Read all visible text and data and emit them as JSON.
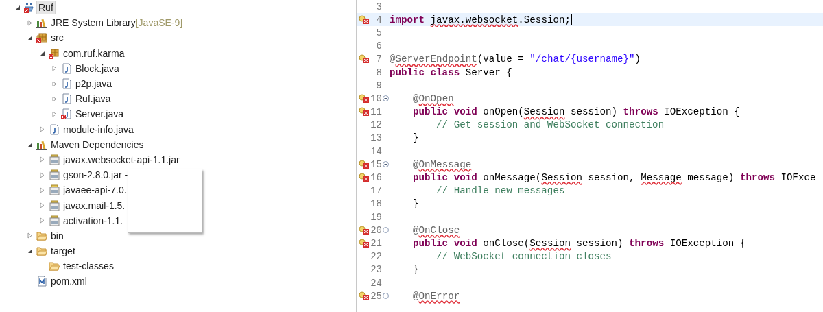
{
  "tree": [
    {
      "label": "Ruf",
      "kind": "project",
      "error": true,
      "selected": true,
      "expanded": true,
      "children": [
        {
          "label": "JRE System Library",
          "suffix": "[JavaSE-9]",
          "kind": "library",
          "error": false,
          "selected": false,
          "expanded": false
        },
        {
          "label": "src",
          "kind": "source-folder",
          "error": true,
          "selected": false,
          "expanded": true,
          "children": [
            {
              "label": "com.ruf.karma",
              "kind": "package",
              "error": true,
              "selected": false,
              "expanded": true,
              "children": [
                {
                  "label": "Block.java",
                  "kind": "java-file",
                  "error": false,
                  "selected": false,
                  "expanded": false
                },
                {
                  "label": "p2p.java",
                  "kind": "java-file",
                  "error": false,
                  "selected": false,
                  "expanded": false
                },
                {
                  "label": "Ruf.java",
                  "kind": "java-file",
                  "error": false,
                  "selected": false,
                  "expanded": false
                },
                {
                  "label": "Server.java",
                  "kind": "java-file",
                  "error": true,
                  "selected": false,
                  "expanded": false
                }
              ]
            },
            {
              "label": "module-info.java",
              "kind": "java-file",
              "error": false,
              "selected": false,
              "expanded": false
            }
          ]
        },
        {
          "label": "Maven Dependencies",
          "kind": "library",
          "error": false,
          "selected": false,
          "expanded": true,
          "children": [
            {
              "label": "javax.websocket-api-1.1.jar",
              "kind": "jar",
              "error": false,
              "selected": false,
              "expanded": false
            },
            {
              "label": "gson-2.8.0.jar -",
              "kind": "jar",
              "error": false,
              "selected": false,
              "expanded": false
            },
            {
              "label": "javaee-api-7.0.",
              "kind": "jar",
              "error": false,
              "selected": false,
              "expanded": false
            },
            {
              "label": "javax.mail-1.5.",
              "kind": "jar",
              "error": false,
              "selected": false,
              "expanded": false
            },
            {
              "label": "activation-1.1.",
              "kind": "jar",
              "error": false,
              "selected": false,
              "expanded": false
            }
          ]
        },
        {
          "label": "bin",
          "kind": "folder",
          "error": false,
          "selected": false,
          "expanded": false
        },
        {
          "label": "target",
          "kind": "folder",
          "error": false,
          "selected": false,
          "expanded": true,
          "children": [
            {
              "label": "test-classes",
              "kind": "folder",
              "error": false,
              "selected": false
            }
          ]
        },
        {
          "label": "pom.xml",
          "kind": "xml-file",
          "error": false,
          "selected": false
        }
      ]
    }
  ],
  "editor": {
    "lines": [
      {
        "number": "3",
        "error": false,
        "fold": false,
        "current": false
      },
      {
        "number": "4",
        "error": true,
        "fold": false,
        "current": true,
        "segments": [
          {
            "kind": "keyword",
            "text": "import "
          },
          {
            "kind": "plain",
            "text": "javax.websocket",
            "squiggle": true
          },
          {
            "kind": "plain",
            "text": ".Session;"
          }
        ]
      },
      {
        "number": "5",
        "error": false,
        "fold": false,
        "current": false
      },
      {
        "number": "6",
        "error": false,
        "fold": false,
        "current": false
      },
      {
        "number": "7",
        "error": true,
        "fold": false,
        "current": false,
        "segments": [
          {
            "kind": "annotation",
            "text": "@"
          },
          {
            "kind": "annotation",
            "text": "ServerEndpoint",
            "squiggle": true
          },
          {
            "kind": "plain",
            "text": "(value = "
          },
          {
            "kind": "string",
            "text": "\"/chat/{username}\""
          },
          {
            "kind": "plain",
            "text": ")"
          }
        ]
      },
      {
        "number": "8",
        "error": false,
        "fold": false,
        "current": false,
        "segments": [
          {
            "kind": "keyword",
            "text": "public class"
          },
          {
            "kind": "plain",
            "text": " Server {"
          }
        ]
      },
      {
        "number": "9",
        "error": false,
        "fold": false,
        "current": false
      },
      {
        "number": "10",
        "error": true,
        "fold": true,
        "current": false,
        "segments": [
          {
            "kind": "annotation",
            "text": "    @"
          },
          {
            "kind": "annotation",
            "text": "OnOpen",
            "squiggle": true
          }
        ]
      },
      {
        "number": "11",
        "error": true,
        "fold": false,
        "current": false,
        "segments": [
          {
            "kind": "keyword",
            "text": "    public void"
          },
          {
            "kind": "plain",
            "text": " onOpen("
          },
          {
            "kind": "plain",
            "text": "Session",
            "squiggle": true
          },
          {
            "kind": "plain",
            "text": " session) "
          },
          {
            "kind": "keyword",
            "text": "throws"
          },
          {
            "kind": "plain",
            "text": " IOException {"
          }
        ]
      },
      {
        "number": "12",
        "error": false,
        "fold": false,
        "current": false,
        "segments": [
          {
            "kind": "comment",
            "text": "        // Get session and WebSocket connection"
          }
        ]
      },
      {
        "number": "13",
        "error": false,
        "fold": false,
        "current": false,
        "segments": [
          {
            "kind": "plain",
            "text": "    }"
          }
        ]
      },
      {
        "number": "14",
        "error": false,
        "fold": false,
        "current": false
      },
      {
        "number": "15",
        "error": true,
        "fold": true,
        "current": false,
        "segments": [
          {
            "kind": "annotation",
            "text": "    @"
          },
          {
            "kind": "annotation",
            "text": "OnMessage",
            "squiggle": true
          }
        ]
      },
      {
        "number": "16",
        "error": true,
        "fold": false,
        "current": false,
        "segments": [
          {
            "kind": "keyword",
            "text": "    public void"
          },
          {
            "kind": "plain",
            "text": " onMessage("
          },
          {
            "kind": "plain",
            "text": "Session",
            "squiggle": true
          },
          {
            "kind": "plain",
            "text": " session, "
          },
          {
            "kind": "plain",
            "text": "Message",
            "squiggle": true
          },
          {
            "kind": "plain",
            "text": " message) "
          },
          {
            "kind": "keyword",
            "text": "throws"
          },
          {
            "kind": "plain",
            "text": " IOExce"
          }
        ]
      },
      {
        "number": "17",
        "error": false,
        "fold": false,
        "current": false,
        "segments": [
          {
            "kind": "comment",
            "text": "        // Handle new messages"
          }
        ]
      },
      {
        "number": "18",
        "error": false,
        "fold": false,
        "current": false,
        "segments": [
          {
            "kind": "plain",
            "text": "    }"
          }
        ]
      },
      {
        "number": "19",
        "error": false,
        "fold": false,
        "current": false
      },
      {
        "number": "20",
        "error": true,
        "fold": true,
        "current": false,
        "segments": [
          {
            "kind": "annotation",
            "text": "    @"
          },
          {
            "kind": "annotation",
            "text": "OnClose",
            "squiggle": true
          }
        ]
      },
      {
        "number": "21",
        "error": true,
        "fold": false,
        "current": false,
        "segments": [
          {
            "kind": "keyword",
            "text": "    public void"
          },
          {
            "kind": "plain",
            "text": " onClose("
          },
          {
            "kind": "plain",
            "text": "Session",
            "squiggle": true
          },
          {
            "kind": "plain",
            "text": " session) "
          },
          {
            "kind": "keyword",
            "text": "throws"
          },
          {
            "kind": "plain",
            "text": " IOException {"
          }
        ]
      },
      {
        "number": "22",
        "error": false,
        "fold": false,
        "current": false,
        "segments": [
          {
            "kind": "comment",
            "text": "        // WebSocket connection closes"
          }
        ]
      },
      {
        "number": "23",
        "error": false,
        "fold": false,
        "current": false,
        "segments": [
          {
            "kind": "plain",
            "text": "    }"
          }
        ]
      },
      {
        "number": "24",
        "error": false,
        "fold": false,
        "current": false
      },
      {
        "number": "25",
        "error": true,
        "fold": true,
        "current": false,
        "segments": [
          {
            "kind": "annotation",
            "text": "    @"
          },
          {
            "kind": "annotation",
            "text": "OnError",
            "squiggle": true
          }
        ]
      }
    ]
  }
}
